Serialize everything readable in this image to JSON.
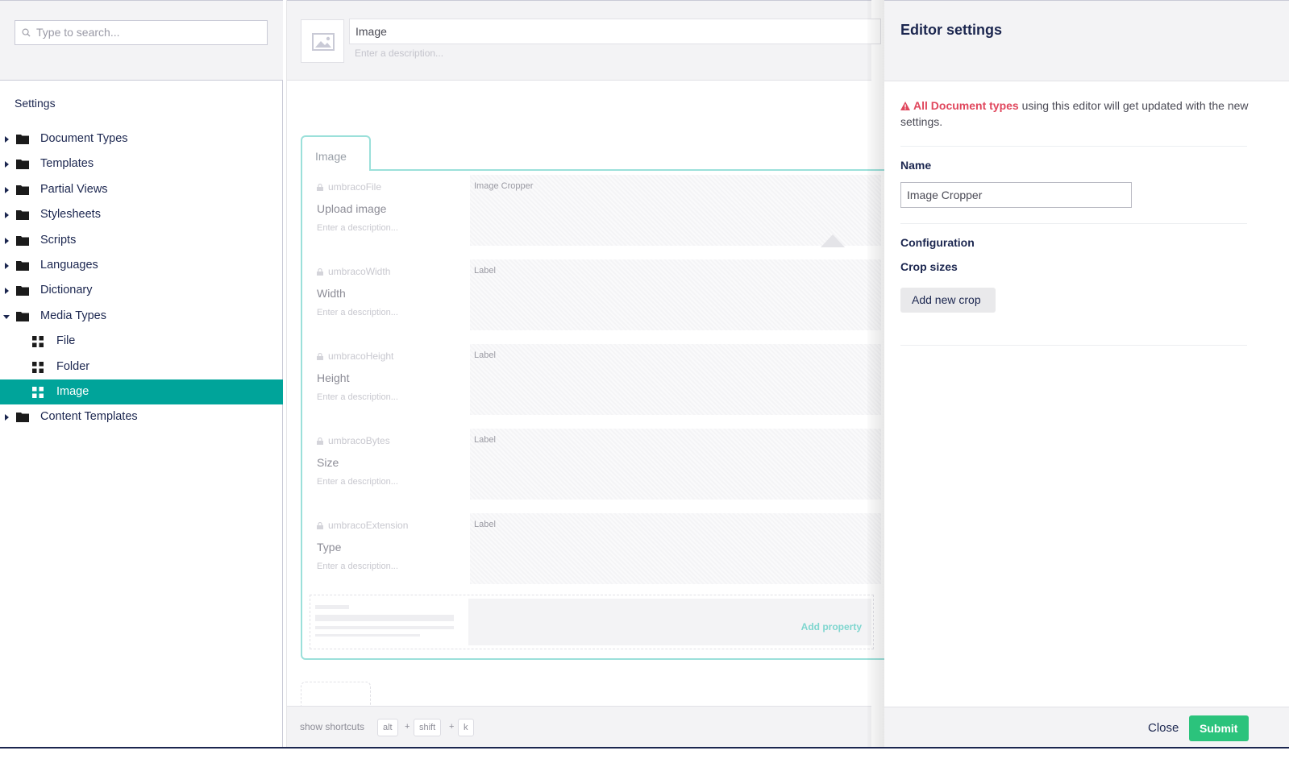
{
  "tree": {
    "search_placeholder": "Type to search...",
    "section_title": "Settings",
    "items": [
      {
        "label": "Document Types"
      },
      {
        "label": "Templates"
      },
      {
        "label": "Partial Views"
      },
      {
        "label": "Stylesheets"
      },
      {
        "label": "Scripts"
      },
      {
        "label": "Languages"
      },
      {
        "label": "Dictionary"
      },
      {
        "label": "Media Types"
      },
      {
        "label": "File"
      },
      {
        "label": "Folder"
      },
      {
        "label": "Image"
      },
      {
        "label": "Content Templates"
      }
    ]
  },
  "editor": {
    "name": "Image",
    "description_placeholder": "Enter a description...",
    "tab_label": "Image",
    "properties": [
      {
        "alias": "umbracoFile",
        "name": "Upload image",
        "description": "Enter a description...",
        "editor": "Image Cropper"
      },
      {
        "alias": "umbracoWidth",
        "name": "Width",
        "description": "Enter a description...",
        "editor": "Label"
      },
      {
        "alias": "umbracoHeight",
        "name": "Height",
        "description": "Enter a description...",
        "editor": "Label"
      },
      {
        "alias": "umbracoBytes",
        "name": "Size",
        "description": "Enter a description...",
        "editor": "Label"
      },
      {
        "alias": "umbracoExtension",
        "name": "Type",
        "description": "Enter a description...",
        "editor": "Label"
      }
    ],
    "add_property": "Add property",
    "footer": {
      "show_shortcuts": "show shortcuts",
      "key1": "alt",
      "key2": "shift",
      "key3": "k",
      "plus": "+"
    }
  },
  "panel": {
    "title": "Editor settings",
    "warning_highlight": "All Document types",
    "warning_rest": " using this editor will get updated with the new settings.",
    "name_label": "Name",
    "name_value": "Image Cropper",
    "config_label": "Configuration",
    "crop_label": "Crop sizes",
    "add_crop": "Add new crop",
    "close": "Close",
    "submit": "Submit"
  },
  "colors": {
    "accent": "#00a49a",
    "submit": "#2bc37c",
    "warning": "#e0475d"
  }
}
